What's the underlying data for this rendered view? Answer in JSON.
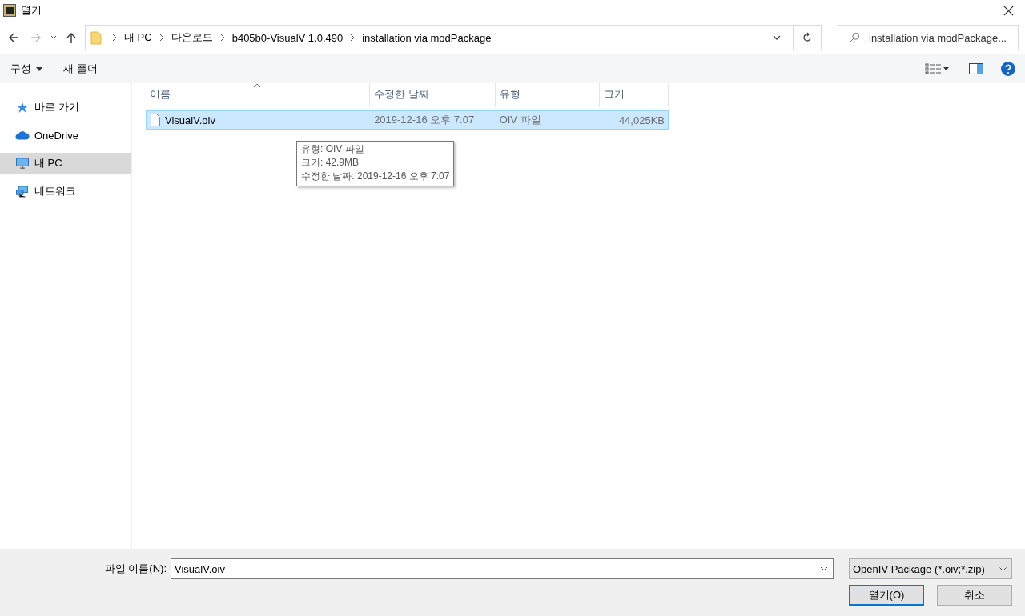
{
  "window": {
    "title": "열기"
  },
  "address": {
    "crumbs": [
      "내 PC",
      "다운로드",
      "b405b0-VisualV 1.0.490",
      "installation via modPackage"
    ]
  },
  "search": {
    "placeholder": "installation via modPackage..."
  },
  "toolbar": {
    "organize": "구성",
    "new_folder": "새 폴더"
  },
  "sidebar": {
    "items": [
      {
        "label": "바로 가기",
        "kind": "star",
        "selected": false
      },
      {
        "label": "OneDrive",
        "kind": "cloud",
        "selected": false
      },
      {
        "label": "내 PC",
        "kind": "pc",
        "selected": true
      },
      {
        "label": "네트워크",
        "kind": "network",
        "selected": false
      }
    ]
  },
  "table": {
    "columns": [
      "이름",
      "수정한 날짜",
      "유형",
      "크기"
    ],
    "rows": [
      {
        "name": "VisualV.oiv",
        "date": "2019-12-16 오후 7:07",
        "type": "OIV 파일",
        "size": "44,025KB",
        "selected": true
      }
    ]
  },
  "tooltip": {
    "lines": [
      "유형: OIV 파일",
      "크기: 42.9MB",
      "수정한 날짜: 2019-12-16 오후 7:07"
    ]
  },
  "footer": {
    "filename_label": "파일 이름(N):",
    "filename": "VisualV.oiv",
    "filter": "OpenIV Package (*.oiv;*.zip)",
    "open_button": "열기(O)",
    "cancel_button": "취소"
  }
}
